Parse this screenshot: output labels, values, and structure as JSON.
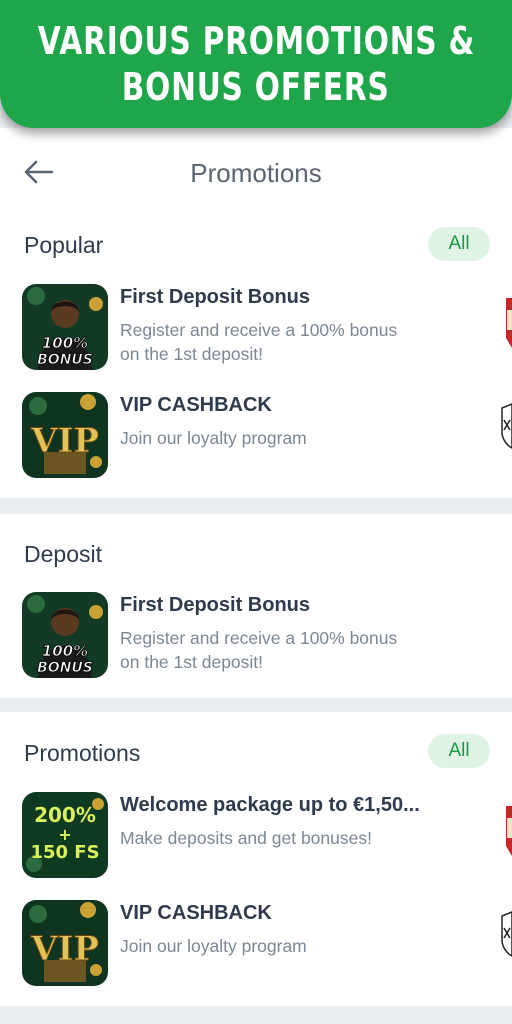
{
  "banner": {
    "line1": "VARIOUS PROMOTIONS &",
    "line2": "BONUS OFFERS"
  },
  "header": {
    "title": "Promotions"
  },
  "sections": [
    {
      "title": "Popular",
      "all_label": "All",
      "items": [
        {
          "title": "First Deposit Bonus",
          "desc_line1": "Register and receive a 100% bonus",
          "desc_line2": "on the 1st deposit!",
          "badge_line1": "100%",
          "badge_line2": "BONUS"
        },
        {
          "title": "VIP CASHBACK",
          "desc_line1": "Join our loyalty program",
          "badge_line1": "VIP"
        }
      ]
    },
    {
      "title": "Deposit",
      "items": [
        {
          "title": "First Deposit Bonus",
          "desc_line1": "Register and receive a 100% bonus",
          "desc_line2": "on the 1st deposit!",
          "badge_line1": "100%",
          "badge_line2": "BONUS"
        }
      ]
    },
    {
      "title": "Promotions",
      "all_label": "All",
      "items": [
        {
          "title": "Welcome package up to €1,50...",
          "desc_line1": "Make deposits and get bonuses!",
          "badge_line1": "200%",
          "badge_plus": "+",
          "badge_line2": "150 FS"
        },
        {
          "title": "VIP CASHBACK",
          "desc_line1": "Join our loyalty program",
          "badge_line1": "VIP"
        }
      ]
    }
  ],
  "colors": {
    "brand_green": "#1fa54a",
    "pill_bg": "#dff3e4",
    "pill_text": "#1c9a47",
    "page_bg": "#e9edf2"
  },
  "icons": {
    "back": "arrow-left-icon"
  }
}
